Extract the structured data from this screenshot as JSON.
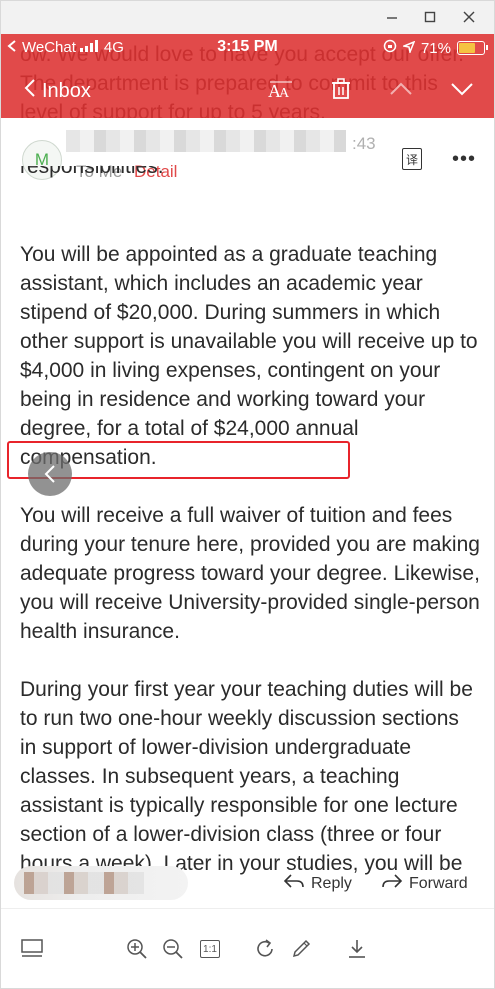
{
  "status_bar": {
    "carrier": "WeChat",
    "network": "4G",
    "time": "3:15 PM",
    "battery": "71%",
    "battery_fraction": 0.71
  },
  "nav": {
    "back_label": "Inbox",
    "back_icon": "chevron-left-icon",
    "font_size_icon": "font-size-icon",
    "delete_icon": "trash-icon",
    "prev_icon": "chevron-up-icon",
    "next_icon": "chevron-down-icon"
  },
  "background_text": "ow. We would love to have you accept our offer. The department is prepared to commit to this level of support for up to 5 years,",
  "sender": {
    "avatar_letter": "M",
    "time_fragment": ":43",
    "to_label": "To Me",
    "detail_label": "Detail",
    "translate_glyph": "译"
  },
  "body": {
    "partial_top": "responsibilities.",
    "paragraph_1": "You will be appointed as a graduate teaching assistant, which includes an academic year stipend of $20,000. During summers in which other support is unavailable you will receive up to $4,000 in living expenses, contingent on your being in residence and working toward your degree, for a total of $24,000 annual compensation.",
    "paragraph_2": "You will receive a full waiver of tuition and fees during your tenure here, provided you are making adequate progress toward your degree. Likewise, you will receive University-provided single-person health insurance.",
    "paragraph_3": "During your first year your teaching duties will be to run two one-hour weekly discussion sections in support of lower-division undergraduate classes. In subsequent years, a teaching assistant is typically responsible for one lecture section of a lower-division class (three or four hours a week). Later in your studies, you will be"
  },
  "reply_bar": {
    "reply_label": "Reply",
    "forward_label": "Forward"
  },
  "toolbar": {
    "ratio_label": "1:1"
  },
  "colors": {
    "header_red": "#e14a4a",
    "highlight_red": "#e8242b",
    "detail_red": "#e14a4a"
  }
}
